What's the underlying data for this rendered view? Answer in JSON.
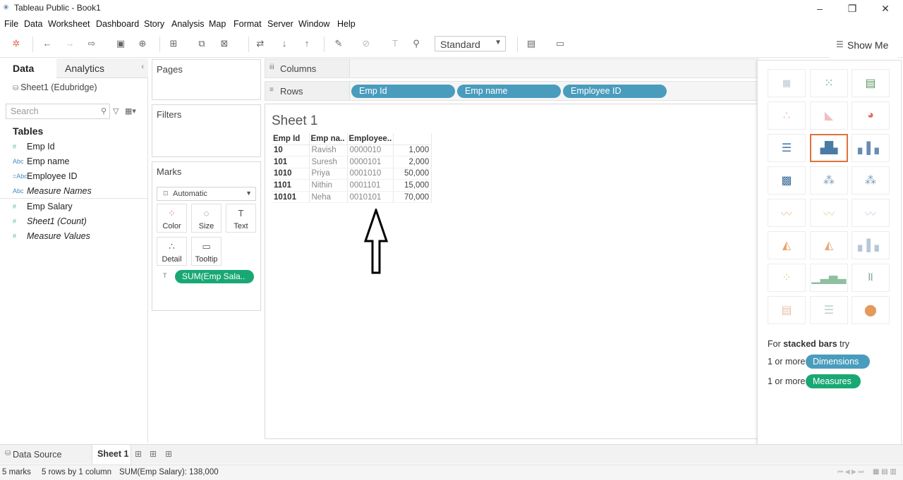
{
  "window": {
    "title": "Tableau Public - Book1"
  },
  "menu": [
    "File",
    "Data",
    "Worksheet",
    "Dashboard",
    "Story",
    "Analysis",
    "Map",
    "Format",
    "Server",
    "Window",
    "Help"
  ],
  "toolbar": {
    "fit_select": "Standard",
    "show_me_label": "Show Me"
  },
  "data_pane": {
    "tab_data": "Data",
    "tab_analytics": "Analytics",
    "datasource": "Sheet1 (Edubridge)",
    "search_placeholder": "Search",
    "tables_heading": "Tables",
    "dimensions": [
      "Emp Id",
      "Emp name",
      "Employee ID",
      "Measure Names"
    ],
    "measures": [
      "Emp Salary",
      "Sheet1 (Count)",
      "Measure Values"
    ]
  },
  "cards": {
    "pages": "Pages",
    "filters": "Filters",
    "marks": "Marks",
    "mark_type": "Automatic",
    "buttons": [
      "Color",
      "Size",
      "Text",
      "Detail",
      "Tooltip"
    ],
    "text_pill": "SUM(Emp Sala.."
  },
  "shelves": {
    "columns": "Columns",
    "rows": "Rows",
    "row_pills": [
      "Emp Id",
      "Emp name",
      "Employee ID"
    ]
  },
  "view": {
    "sheet_title": "Sheet 1",
    "headers": [
      "Emp Id",
      "Emp na..",
      "Employee.."
    ],
    "rows": [
      [
        "10",
        "Ravish",
        "0000010",
        "1,000"
      ],
      [
        "101",
        "Suresh",
        "0000101",
        "2,000"
      ],
      [
        "1010",
        "Priya",
        "0001010",
        "50,000"
      ],
      [
        "1101",
        "Nithin",
        "0001101",
        "15,000"
      ],
      [
        "10101",
        "Neha",
        "0010101",
        "70,000"
      ]
    ]
  },
  "show_me": {
    "hint_prefix": "For",
    "hint_bold": "stacked bars",
    "hint_suffix": "try",
    "req1": "1 or more",
    "req1_pill": "Dimensions",
    "req2": "1 or more",
    "req2_pill": "Measures"
  },
  "tabs": {
    "data_source": "Data Source",
    "sheet": "Sheet 1"
  },
  "status": {
    "marks": "5 marks",
    "dims": "5 rows by 1 column",
    "sum": "SUM(Emp Salary): 138,000"
  }
}
